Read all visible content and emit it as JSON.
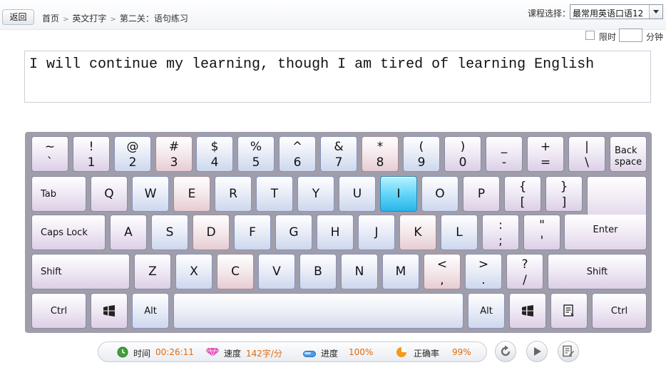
{
  "header": {
    "back_label": "返回",
    "breadcrumb": [
      "首页",
      "英文打字",
      "第二关：语句练习"
    ],
    "breadcrumb_separator": ">",
    "course_label": "课程选择：",
    "course_value": "最常用英语口语12",
    "limit_label": "限时",
    "limit_value": "",
    "minute_label": "分钟"
  },
  "practice": {
    "text": "I will continue my learning, though I am tired of learning English"
  },
  "keyboard": {
    "row1": [
      {
        "top": "~",
        "bottom": "`"
      },
      {
        "top": "!",
        "bottom": "1"
      },
      {
        "top": "@",
        "bottom": "2"
      },
      {
        "top": "#",
        "bottom": "3"
      },
      {
        "top": "$",
        "bottom": "4"
      },
      {
        "top": "%",
        "bottom": "5"
      },
      {
        "top": "^",
        "bottom": "6"
      },
      {
        "top": "&",
        "bottom": "7"
      },
      {
        "top": "*",
        "bottom": "8"
      },
      {
        "top": "(",
        "bottom": "9"
      },
      {
        "top": ")",
        "bottom": "0"
      },
      {
        "top": "_",
        "bottom": "-"
      },
      {
        "top": "+",
        "bottom": "="
      },
      {
        "top": "|",
        "bottom": "\\"
      }
    ],
    "backspace": [
      "Back",
      "space"
    ],
    "tab": "Tab",
    "row2": [
      "Q",
      "W",
      "E",
      "R",
      "T",
      "Y",
      "U",
      "I",
      "O",
      "P"
    ],
    "row2_sym": [
      {
        "top": "{",
        "bottom": "["
      },
      {
        "top": "}",
        "bottom": "]"
      }
    ],
    "caps": "Caps Lock",
    "row3": [
      "A",
      "S",
      "D",
      "F",
      "G",
      "H",
      "J",
      "K",
      "L"
    ],
    "row3_sym": [
      {
        "top": ":",
        "bottom": ";"
      },
      {
        "top": "\"",
        "bottom": "'"
      }
    ],
    "enter": "Enter",
    "shift": "Shift",
    "row4": [
      "Z",
      "X",
      "C",
      "V",
      "B",
      "N",
      "M"
    ],
    "row4_sym": [
      {
        "top": "<",
        "bottom": ","
      },
      {
        "top": ">",
        "bottom": "."
      },
      {
        "top": "?",
        "bottom": "/"
      }
    ],
    "ctrl": "Ctrl",
    "alt": "Alt",
    "active_key": "I",
    "colors": {
      "active": "#3cc3f0",
      "purple": "#dccfe6",
      "blue": "#cdd7ee",
      "pink": "#e6ccd3",
      "frame": "#a09eab"
    }
  },
  "status": {
    "time_label": "时间",
    "time_value": "00:26:11",
    "speed_label": "速度",
    "speed_value": "142字/分",
    "progress_label": "进度",
    "progress_value": "100%",
    "accuracy_label": "正确率",
    "accuracy_value": "99%",
    "value_color": "#e06a0b"
  },
  "icons": [
    "clock-icon",
    "diamond-icon",
    "progress-pill-icon",
    "pie-icon",
    "restart-icon",
    "play-icon",
    "notes-icon",
    "windows-icon",
    "menu-icon"
  ]
}
